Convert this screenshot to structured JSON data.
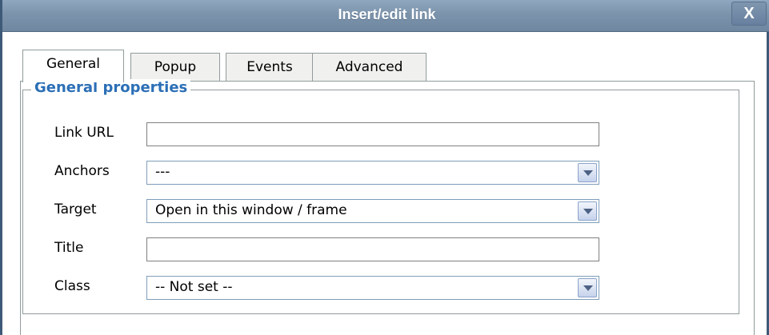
{
  "dialog": {
    "title": "Insert/edit link",
    "close_label": "X"
  },
  "tabs": [
    {
      "label": "General",
      "active": true
    },
    {
      "label": "Popup",
      "active": false
    },
    {
      "label": "Events",
      "active": false
    },
    {
      "label": "Advanced",
      "active": false
    }
  ],
  "general": {
    "legend": "General properties",
    "fields": {
      "link_url": {
        "label": "Link URL",
        "value": ""
      },
      "anchors": {
        "label": "Anchors",
        "value": "---"
      },
      "target": {
        "label": "Target",
        "value": "Open in this window / frame"
      },
      "title": {
        "label": "Title",
        "value": ""
      },
      "class": {
        "label": "Class",
        "value": "-- Not set --"
      }
    }
  },
  "colors": {
    "titlebar": "#7b93ab",
    "legend": "#2b6fb6",
    "border": "#919b9c"
  },
  "icons": {
    "close": "close-icon",
    "dropdown": "chevron-down-icon"
  }
}
